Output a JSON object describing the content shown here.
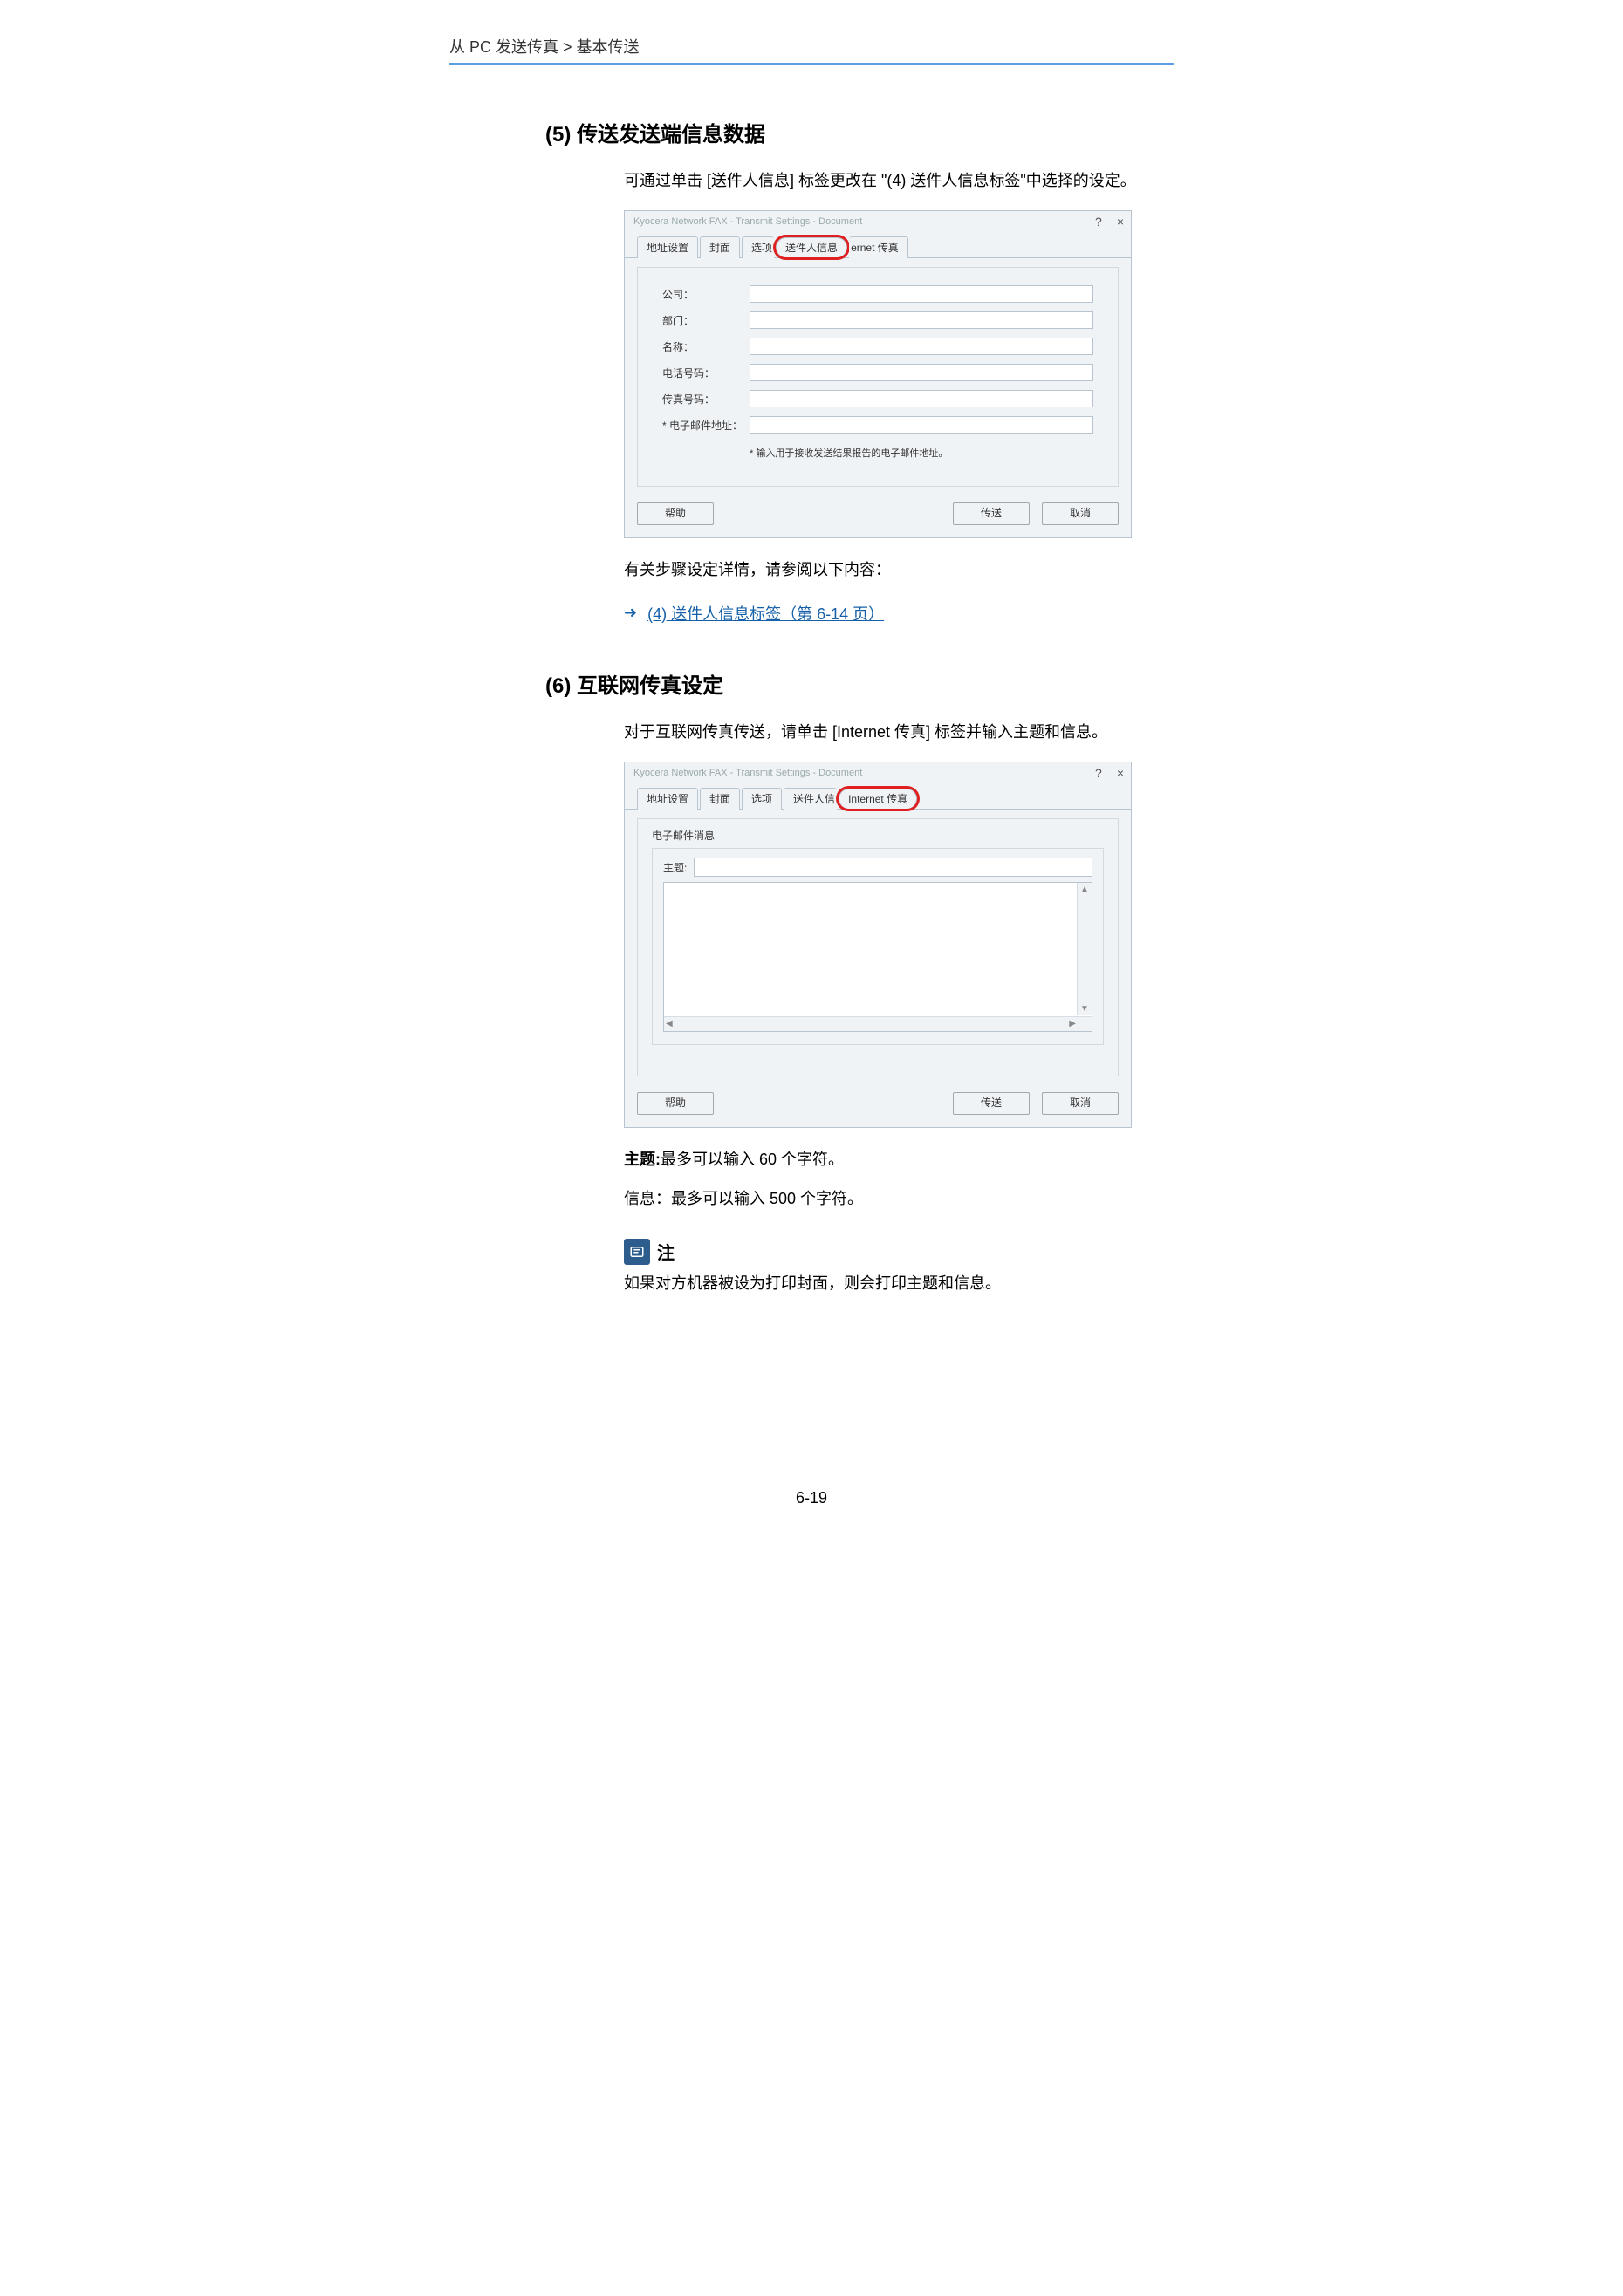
{
  "breadcrumb": "从 PC 发送传真 > 基本传送",
  "sec5": {
    "heading": "(5) 传送发送端信息数据",
    "para": "可通过单击 [送件人信息] 标签更改在 \"(4) 送件人信息标签\"中选择的设定。",
    "after_para": "有关步骤设定详情，请参阅以下内容：",
    "ref_link": "(4) 送件人信息标签（第 6-14 页）"
  },
  "sec6": {
    "heading": "(6) 互联网传真设定",
    "para": "对于互联网传真传送，请单击 [Internet 传真] 标签并输入主题和信息。",
    "subject_line_label": "主题:",
    "subject_line_text": "最多可以输入 60 个字符。",
    "info_line_label": "信息：",
    "info_line_text": "最多可以输入 500 个字符。",
    "note_title": "注",
    "note_text": "如果对方机器被设为打印封面，则会打印主题和信息。"
  },
  "dialog1": {
    "title": "Kyocera Network FAX - Transmit Settings - Document",
    "help_icon": "?",
    "close_icon": "×",
    "tabs": {
      "t1": "地址设置",
      "t2": "封面",
      "t3": "选项",
      "t4_circled": "送件人信息",
      "t5_frag": "ernet 传真"
    },
    "fields": {
      "company": "公司：",
      "dept": "部门：",
      "name": "名称：",
      "phone": "电话号码：",
      "fax": "传真号码：",
      "email": "* 电子邮件地址："
    },
    "note": "* 输入用于接收发送结果报告的电子邮件地址。",
    "btn_help": "帮助",
    "btn_send": "传送",
    "btn_cancel": "取消"
  },
  "dialog2": {
    "title": "Kyocera Network FAX - Transmit Settings - Document",
    "help_icon": "?",
    "close_icon": "×",
    "tabs": {
      "t1": "地址设置",
      "t2": "封面",
      "t3": "选项",
      "t4_frag": "送件人信",
      "t5_circled": "Internet 传真"
    },
    "fieldset_label": "电子邮件消息",
    "subject_label": "主题:",
    "btn_help": "帮助",
    "btn_send": "传送",
    "btn_cancel": "取消"
  },
  "page_number": "6-19"
}
